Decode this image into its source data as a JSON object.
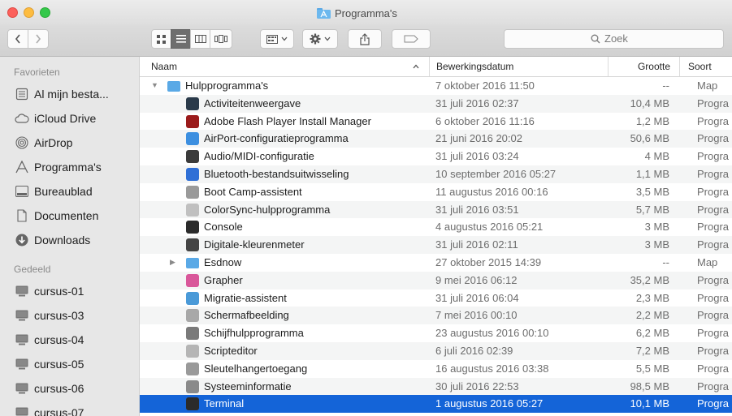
{
  "caption_top": "",
  "window": {
    "title": "Programma's"
  },
  "toolbar": {
    "search_placeholder": "Zoek",
    "view_buttons": [
      "icon-view",
      "list-view",
      "column-view",
      "coverflow-view"
    ],
    "arrange_label": "arrange",
    "action_label": "action",
    "share_label": "share",
    "tags_label": "tags"
  },
  "sidebar": {
    "favorites_header": "Favorieten",
    "shared_header": "Gedeeld",
    "favorites": [
      {
        "label": "Al mijn besta...",
        "icon": "all-files-icon"
      },
      {
        "label": "iCloud Drive",
        "icon": "cloud-icon"
      },
      {
        "label": "AirDrop",
        "icon": "airdrop-icon"
      },
      {
        "label": "Programma's",
        "icon": "applications-icon"
      },
      {
        "label": "Bureaublad",
        "icon": "desktop-icon"
      },
      {
        "label": "Documenten",
        "icon": "documents-icon"
      },
      {
        "label": "Downloads",
        "icon": "downloads-icon"
      }
    ],
    "shared": [
      {
        "label": "cursus-01",
        "icon": "computer-icon"
      },
      {
        "label": "cursus-03",
        "icon": "computer-icon"
      },
      {
        "label": "cursus-04",
        "icon": "computer-icon"
      },
      {
        "label": "cursus-05",
        "icon": "computer-icon"
      },
      {
        "label": "cursus-06",
        "icon": "computer-icon"
      },
      {
        "label": "cursus-07",
        "icon": "computer-icon"
      }
    ]
  },
  "columns": {
    "name": "Naam",
    "date": "Bewerkingsdatum",
    "size": "Grootte",
    "kind": "Soort"
  },
  "rows": [
    {
      "name": "Hulpprogramma's",
      "date": "7 oktober 2016 11:50",
      "size": "--",
      "kind": "Map",
      "indent": 0,
      "disclosure": "open",
      "icon_color": "#5aa9e6"
    },
    {
      "name": "Activiteitenweergave",
      "date": "31 juli 2016 02:37",
      "size": "10,4 MB",
      "kind": "Progra",
      "indent": 1,
      "icon_color": "#2a3a4a"
    },
    {
      "name": "Adobe Flash Player Install Manager",
      "date": "6 oktober 2016 11:16",
      "size": "1,2 MB",
      "kind": "Progra",
      "indent": 1,
      "icon_color": "#9b1b1b"
    },
    {
      "name": "AirPort-configuratieprogramma",
      "date": "21 juni 2016 20:02",
      "size": "50,6 MB",
      "kind": "Progra",
      "indent": 1,
      "icon_color": "#3c8fe0"
    },
    {
      "name": "Audio/MIDI-configuratie",
      "date": "31 juli 2016 03:24",
      "size": "4 MB",
      "kind": "Progra",
      "indent": 1,
      "icon_color": "#3b3b3b"
    },
    {
      "name": "Bluetooth-bestandsuitwisseling",
      "date": "10 september 2016 05:27",
      "size": "1,1 MB",
      "kind": "Progra",
      "indent": 1,
      "icon_color": "#2f6fd6"
    },
    {
      "name": "Boot Camp-assistent",
      "date": "11 augustus 2016 00:16",
      "size": "3,5 MB",
      "kind": "Progra",
      "indent": 1,
      "icon_color": "#9a9a9a"
    },
    {
      "name": "ColorSync-hulpprogramma",
      "date": "31 juli 2016 03:51",
      "size": "5,7 MB",
      "kind": "Progra",
      "indent": 1,
      "icon_color": "#c0c0c0"
    },
    {
      "name": "Console",
      "date": "4 augustus 2016 05:21",
      "size": "3 MB",
      "kind": "Progra",
      "indent": 1,
      "icon_color": "#2b2b2b"
    },
    {
      "name": "Digitale-kleurenmeter",
      "date": "31 juli 2016 02:11",
      "size": "3 MB",
      "kind": "Progra",
      "indent": 1,
      "icon_color": "#444444"
    },
    {
      "name": "Esdnow",
      "date": "27 oktober 2015 14:39",
      "size": "--",
      "kind": "Map",
      "indent": 1,
      "disclosure": "closed",
      "icon_color": "#5aa9e6"
    },
    {
      "name": "Grapher",
      "date": "9 mei 2016 06:12",
      "size": "35,2 MB",
      "kind": "Progra",
      "indent": 1,
      "icon_color": "#d9579a"
    },
    {
      "name": "Migratie-assistent",
      "date": "31 juli 2016 06:04",
      "size": "2,3 MB",
      "kind": "Progra",
      "indent": 1,
      "icon_color": "#4a9ad8"
    },
    {
      "name": "Schermafbeelding",
      "date": "7 mei 2016 00:10",
      "size": "2,2 MB",
      "kind": "Progra",
      "indent": 1,
      "icon_color": "#a8a8a8"
    },
    {
      "name": "Schijfhulpprogramma",
      "date": "23 augustus 2016 00:10",
      "size": "6,2 MB",
      "kind": "Progra",
      "indent": 1,
      "icon_color": "#7a7a7a"
    },
    {
      "name": "Scripteditor",
      "date": "6 juli 2016 02:39",
      "size": "7,2 MB",
      "kind": "Progra",
      "indent": 1,
      "icon_color": "#b5b5b5"
    },
    {
      "name": "Sleutelhangertoegang",
      "date": "16 augustus 2016 03:38",
      "size": "5,5 MB",
      "kind": "Progra",
      "indent": 1,
      "icon_color": "#9a9a9a"
    },
    {
      "name": "Systeeminformatie",
      "date": "30 juli 2016 22:53",
      "size": "98,5 MB",
      "kind": "Progra",
      "indent": 1,
      "icon_color": "#8a8a8a"
    },
    {
      "name": "Terminal",
      "date": "1 augustus 2016 05:27",
      "size": "10,1 MB",
      "kind": "Progra",
      "indent": 1,
      "selected": true,
      "icon_color": "#2b2b2b"
    }
  ]
}
